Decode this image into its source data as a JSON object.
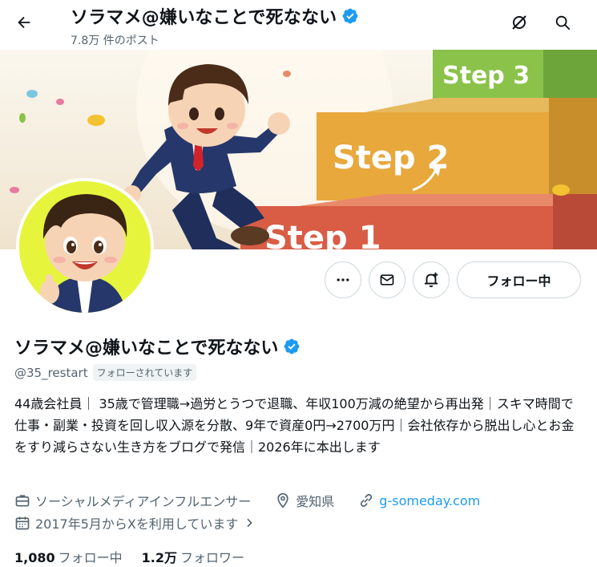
{
  "header": {
    "title": "ソラマメ@嫌いなことで死なない",
    "post_count": "7.8万 件のポスト"
  },
  "banner": {
    "steps": [
      "Step 3",
      "Step 2",
      "Step 1"
    ]
  },
  "actions": {
    "follow_label": "フォロー中"
  },
  "profile": {
    "name": "ソラマメ@嫌いなことで死なない",
    "handle": "@35_restart",
    "follows_you": "フォローされています",
    "bio": "44歳会社員｜ 35歳で管理職→過労とうつで退職、年収100万減の絶望から再出発｜スキマ時間で仕事・副業・投資を回し収入源を分散、9年で資産0円→2700万円｜会社依存から脱出し心とお金をすり減らさない生き方をブログで発信｜2026年に本出します",
    "category": "ソーシャルメディアインフルエンサー",
    "location": "愛知県",
    "website": "g-someday.com",
    "joined": "2017年5月からXを利用しています"
  },
  "stats": {
    "following_count": "1,080",
    "following_label": "フォロー中",
    "followers_count": "1.2万",
    "followers_label": "フォロワー"
  },
  "colors": {
    "accent": "#1d9bf0",
    "verified": "#1d9bf0",
    "muted": "#536471"
  }
}
